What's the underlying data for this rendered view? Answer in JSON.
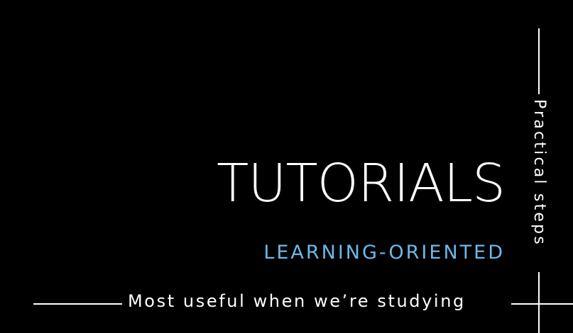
{
  "quadrant": {
    "title": "TUTORIALS",
    "subtitle": "LEARNING-ORIENTED",
    "horizontal_axis_label": "Most useful when we’re studying",
    "vertical_axis_label": "Practical steps"
  },
  "colors": {
    "background": "#000000",
    "title": "#ffffff",
    "subtitle": "#6cb8e8",
    "axis": "#ffffff"
  }
}
